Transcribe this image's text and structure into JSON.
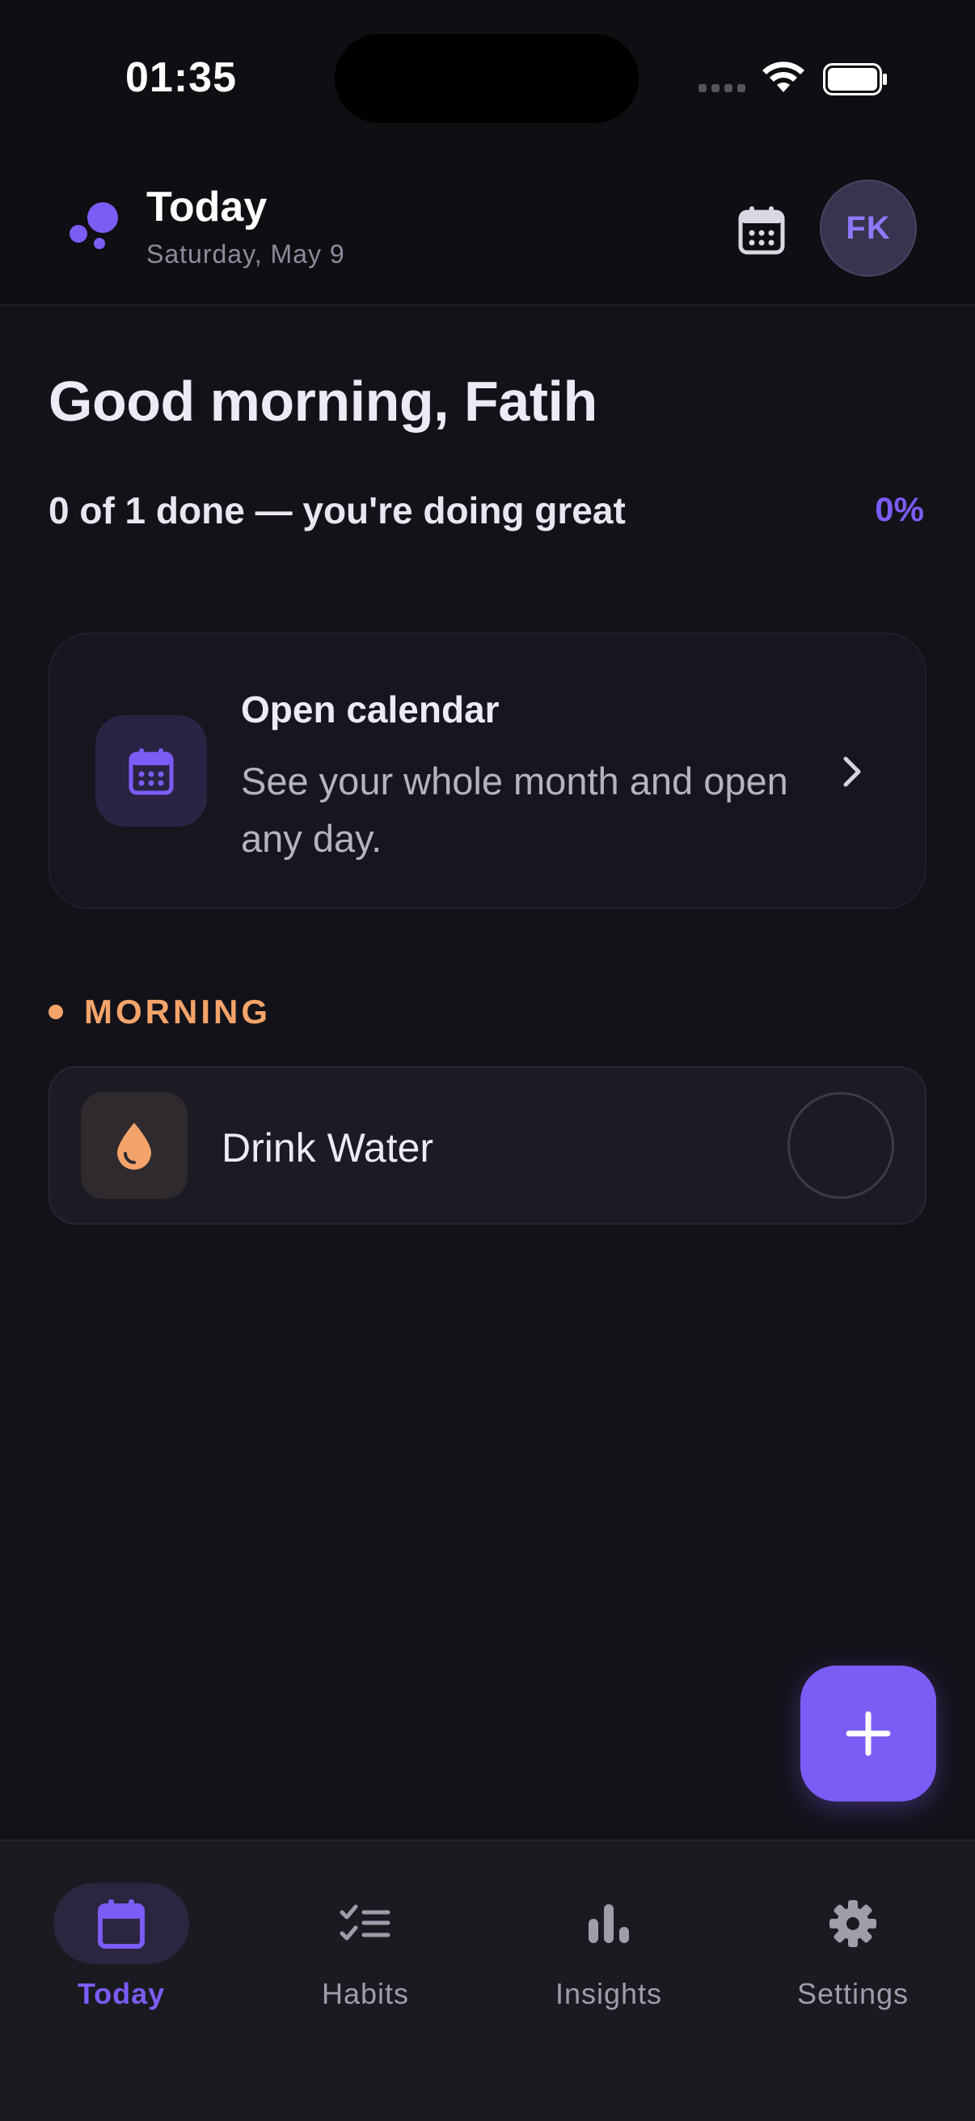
{
  "status_bar": {
    "time": "01:35"
  },
  "header": {
    "title": "Today",
    "date": "Saturday, May 9",
    "avatar_initials": "FK"
  },
  "greeting": "Good morning, Fatih",
  "progress": {
    "text": "0 of 1 done — you're doing great",
    "percent_label": "0%",
    "percent": 0
  },
  "calendar_card": {
    "title": "Open calendar",
    "subtitle": "See your whole month and open any day.",
    "icon": "calendar-icon"
  },
  "sections": [
    {
      "label": "MORNING",
      "color": "#F4A46A",
      "habits": [
        {
          "name": "Drink Water",
          "icon": "water-drop-icon",
          "done": false
        }
      ]
    }
  ],
  "bottom_nav": [
    {
      "label": "Today",
      "icon": "calendar-icon",
      "active": true
    },
    {
      "label": "Habits",
      "icon": "checklist-icon",
      "active": false
    },
    {
      "label": "Insights",
      "icon": "bar-chart-icon",
      "active": false
    },
    {
      "label": "Settings",
      "icon": "gear-icon",
      "active": false
    }
  ],
  "colors": {
    "accent": "#7B5CF5",
    "morning": "#F4A46A",
    "background": "#141219"
  }
}
